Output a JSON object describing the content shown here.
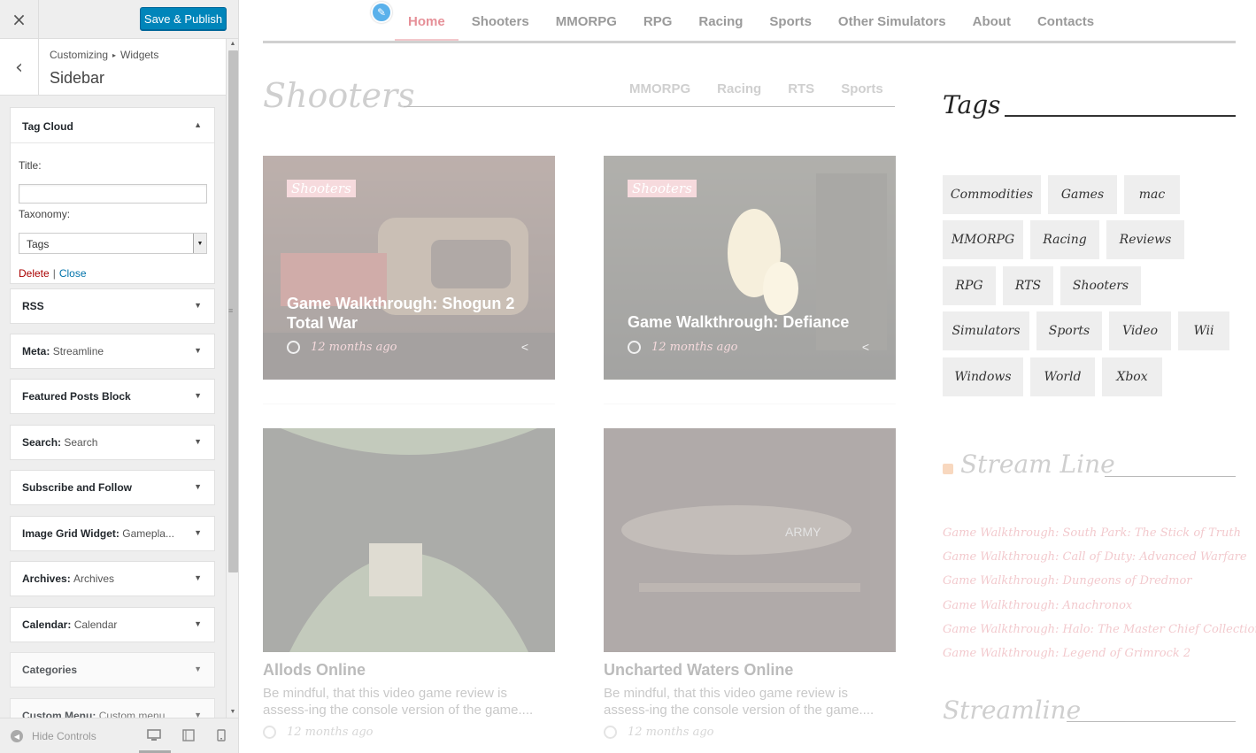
{
  "panel": {
    "close_icon": "×",
    "publish_label": "Save & Publish",
    "back_icon": "‹",
    "breadcrumb": [
      "Customizing",
      "Widgets"
    ],
    "breadcrumb_sep": "▸",
    "section_title": "Sidebar",
    "tag_cloud": {
      "title": "Tag Cloud",
      "title_label": "Title:",
      "title_value": "",
      "taxonomy_label": "Taxonomy:",
      "taxonomy_value": "Tags",
      "delete_label": "Delete",
      "separator": "|",
      "close_label": "Close"
    },
    "widgets": [
      {
        "name": "RSS",
        "sub": ""
      },
      {
        "name": "Meta",
        "sub": "Streamline"
      },
      {
        "name": "Featured Posts Block",
        "sub": ""
      },
      {
        "name": "Search",
        "sub": "Search"
      },
      {
        "name": "Subscribe and Follow",
        "sub": ""
      },
      {
        "name": "Image Grid Widget",
        "sub": "Gamepla..."
      },
      {
        "name": "Archives",
        "sub": "Archives"
      },
      {
        "name": "Calendar",
        "sub": "Calendar"
      },
      {
        "name": "Categories",
        "sub": ""
      },
      {
        "name": "Custom Menu",
        "sub": "Custom menu"
      }
    ],
    "hide_controls_label": "Hide Controls"
  },
  "preview": {
    "nav": [
      "Home",
      "Shooters",
      "MMORPG",
      "RPG",
      "Racing",
      "Sports",
      "Other Simulators",
      "About",
      "Contacts"
    ],
    "active_nav": "Home",
    "category_title": "Shooters",
    "subnav": [
      "MMORPG",
      "Racing",
      "RTS",
      "Sports"
    ],
    "featured": [
      {
        "tag": "Shooters",
        "title": "Game Walkthrough: Shogun 2 Total War",
        "time": "12 months ago"
      },
      {
        "tag": "Shooters",
        "title": "Game Walkthrough: Defiance",
        "time": "12 months ago"
      }
    ],
    "posts": [
      {
        "title": "Allods Online",
        "excerpt": "Be mindful, that this video game review is assess-ing the console version of the game....",
        "time": "12 months ago"
      },
      {
        "title": "Uncharted Waters Online",
        "excerpt": "Be mindful, that this video game review is assess-ing the console version of the game....",
        "time": "12 months ago"
      }
    ],
    "image_text": "ARMY",
    "tags_title": "Tags",
    "tags": [
      "Commodities",
      "Games",
      "mac",
      "MMORPG",
      "Racing",
      "Reviews",
      "RPG",
      "RTS",
      "Shooters",
      "Simulators",
      "Sports",
      "Video",
      "Wii",
      "Windows",
      "World",
      "Xbox"
    ],
    "streamline_title": "Stream Line",
    "streamline_links": [
      "Game Walkthrough: South Park: The Stick of Truth",
      "Game Walkthrough: Call of Duty: Advanced Warfare",
      "Game Walkthrough: Dungeons of Dredmor",
      "Game Walkthrough: Anachronox",
      "Game Walkthrough: Halo: The Master Chief Collection",
      "Game Walkthrough: Legend of Grimrock 2"
    ],
    "streamline2_title": "Streamline"
  },
  "colors": {
    "publish": "#0085ba",
    "accent": "#e07a84",
    "link": "#0073aa",
    "delete": "#aa0000"
  }
}
